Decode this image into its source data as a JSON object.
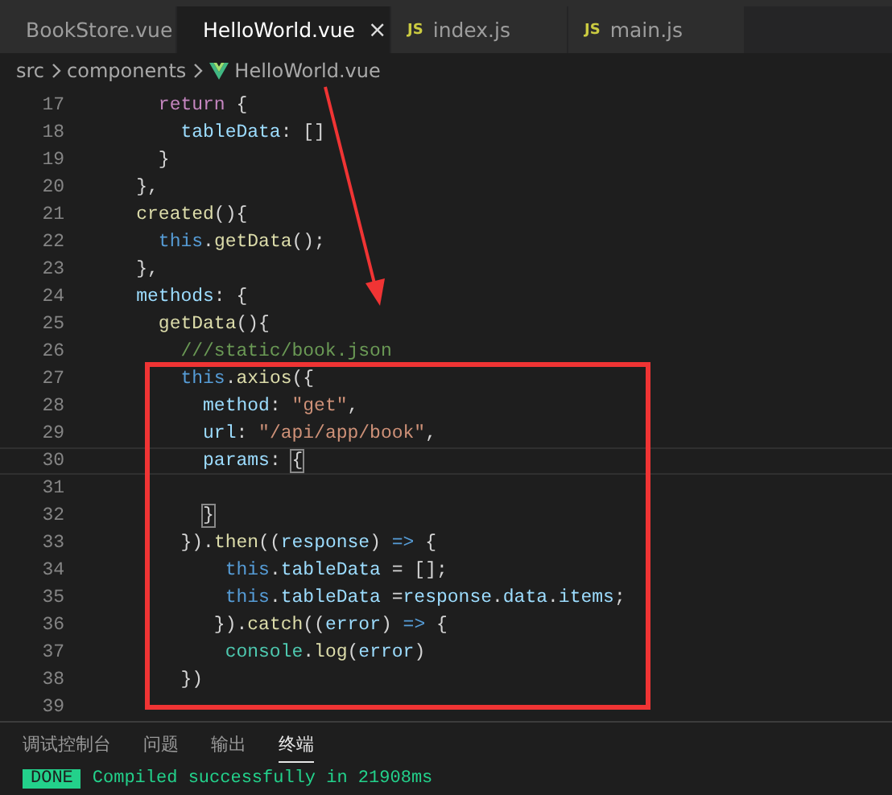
{
  "tabs": [
    {
      "label": "BookStore.vue",
      "kind": "vue",
      "selected": false
    },
    {
      "label": "HelloWorld.vue",
      "kind": "vue",
      "selected": true,
      "close": "×"
    },
    {
      "label": "index.js",
      "kind": "js",
      "badge": "JS",
      "selected": false
    },
    {
      "label": "main.js",
      "kind": "js",
      "badge": "JS",
      "selected": false
    }
  ],
  "breadcrumbs": [
    {
      "label": "src",
      "kind": "folder"
    },
    {
      "label": "components",
      "kind": "folder"
    },
    {
      "label": "HelloWorld.vue",
      "kind": "vue"
    }
  ],
  "code_lines": [
    {
      "number": "17",
      "current": false,
      "tokens": [
        {
          "kind": "keyword",
          "text": "      return"
        },
        {
          "kind": "punct",
          "text": " {"
        }
      ]
    },
    {
      "number": "18",
      "current": false,
      "tokens": [
        {
          "kind": "prop",
          "text": "        tableData"
        },
        {
          "kind": "punct",
          "text": ": []"
        }
      ]
    },
    {
      "number": "19",
      "current": false,
      "tokens": [
        {
          "kind": "punct",
          "text": "      }"
        }
      ]
    },
    {
      "number": "20",
      "current": false,
      "tokens": [
        {
          "kind": "punct",
          "text": "    },"
        }
      ]
    },
    {
      "number": "21",
      "current": false,
      "tokens": [
        {
          "kind": "fn",
          "text": "    created"
        },
        {
          "kind": "punct",
          "text": "(){"
        }
      ]
    },
    {
      "number": "22",
      "current": false,
      "tokens": [
        {
          "kind": "this",
          "text": "      this"
        },
        {
          "kind": "punct",
          "text": "."
        },
        {
          "kind": "fn",
          "text": "getData"
        },
        {
          "kind": "punct",
          "text": "();"
        }
      ]
    },
    {
      "number": "23",
      "current": false,
      "tokens": [
        {
          "kind": "punct",
          "text": "    },"
        }
      ]
    },
    {
      "number": "24",
      "current": false,
      "tokens": [
        {
          "kind": "prop",
          "text": "    methods"
        },
        {
          "kind": "punct",
          "text": ": {"
        }
      ]
    },
    {
      "number": "25",
      "current": false,
      "tokens": [
        {
          "kind": "fn",
          "text": "      getData"
        },
        {
          "kind": "punct",
          "text": "(){"
        }
      ]
    },
    {
      "number": "26",
      "current": false,
      "tokens": [
        {
          "kind": "comment",
          "text": "        ///static/book.json"
        }
      ]
    },
    {
      "number": "27",
      "current": false,
      "tokens": [
        {
          "kind": "this",
          "text": "        this"
        },
        {
          "kind": "punct",
          "text": "."
        },
        {
          "kind": "fn",
          "text": "axios"
        },
        {
          "kind": "punct",
          "text": "({"
        }
      ]
    },
    {
      "number": "28",
      "current": false,
      "tokens": [
        {
          "kind": "prop",
          "text": "          method"
        },
        {
          "kind": "punct",
          "text": ": "
        },
        {
          "kind": "string",
          "text": "\"get\""
        },
        {
          "kind": "punct",
          "text": ","
        }
      ]
    },
    {
      "number": "29",
      "current": false,
      "tokens": [
        {
          "kind": "prop",
          "text": "          url"
        },
        {
          "kind": "punct",
          "text": ": "
        },
        {
          "kind": "string",
          "text": "\"/api/app/book\""
        },
        {
          "kind": "punct",
          "text": ","
        }
      ]
    },
    {
      "number": "30",
      "current": true,
      "tokens": [
        {
          "kind": "prop",
          "text": "          params"
        },
        {
          "kind": "punct",
          "text": ": "
        },
        {
          "kind": "match",
          "text": "{"
        }
      ]
    },
    {
      "number": "31",
      "current": false
    },
    {
      "number": "32",
      "current": false,
      "tokens": [
        {
          "kind": "match",
          "text": "          }"
        }
      ]
    },
    {
      "number": "33",
      "current": false,
      "tokens": [
        {
          "kind": "punct",
          "text": "        })."
        },
        {
          "kind": "fn",
          "text": "then"
        },
        {
          "kind": "punct",
          "text": "(("
        },
        {
          "kind": "prop",
          "text": "response"
        },
        {
          "kind": "punct",
          "text": ") "
        },
        {
          "kind": "this",
          "text": "=>"
        },
        {
          "kind": "punct",
          "text": " {"
        }
      ]
    },
    {
      "number": "34",
      "current": false,
      "tokens": [
        {
          "kind": "this",
          "text": "            this"
        },
        {
          "kind": "punct",
          "text": "."
        },
        {
          "kind": "prop",
          "text": "tableData"
        },
        {
          "kind": "punct",
          "text": " = [];"
        }
      ]
    },
    {
      "number": "35",
      "current": false,
      "tokens": [
        {
          "kind": "this",
          "text": "            this"
        },
        {
          "kind": "punct",
          "text": "."
        },
        {
          "kind": "prop",
          "text": "tableData"
        },
        {
          "kind": "punct",
          "text": " ="
        },
        {
          "kind": "prop",
          "text": "response"
        },
        {
          "kind": "punct",
          "text": "."
        },
        {
          "kind": "prop",
          "text": "data"
        },
        {
          "kind": "punct",
          "text": "."
        },
        {
          "kind": "prop",
          "text": "items"
        },
        {
          "kind": "punct",
          "text": ";"
        }
      ]
    },
    {
      "number": "36",
      "current": false,
      "tokens": [
        {
          "kind": "punct",
          "text": "           })."
        },
        {
          "kind": "fn",
          "text": "catch"
        },
        {
          "kind": "punct",
          "text": "(("
        },
        {
          "kind": "prop",
          "text": "error"
        },
        {
          "kind": "punct",
          "text": ") "
        },
        {
          "kind": "this",
          "text": "=>"
        },
        {
          "kind": "punct",
          "text": " {"
        }
      ]
    },
    {
      "number": "37",
      "current": false,
      "tokens": [
        {
          "kind": "class",
          "text": "            console"
        },
        {
          "kind": "punct",
          "text": "."
        },
        {
          "kind": "fn",
          "text": "log"
        },
        {
          "kind": "punct",
          "text": "("
        },
        {
          "kind": "prop",
          "text": "error"
        },
        {
          "kind": "punct",
          "text": ")"
        }
      ]
    },
    {
      "number": "38",
      "current": false,
      "tokens": [
        {
          "kind": "punct",
          "text": "        })"
        }
      ]
    },
    {
      "number": "39",
      "current": false
    }
  ],
  "panel_tabs": [
    {
      "label": "调试控制台",
      "selected": false
    },
    {
      "label": "问题",
      "selected": false
    },
    {
      "label": "输出",
      "selected": false
    },
    {
      "label": "终端",
      "selected": true
    }
  ],
  "terminal": {
    "badge": "DONE",
    "message": "Compiled successfully in 21908ms"
  }
}
